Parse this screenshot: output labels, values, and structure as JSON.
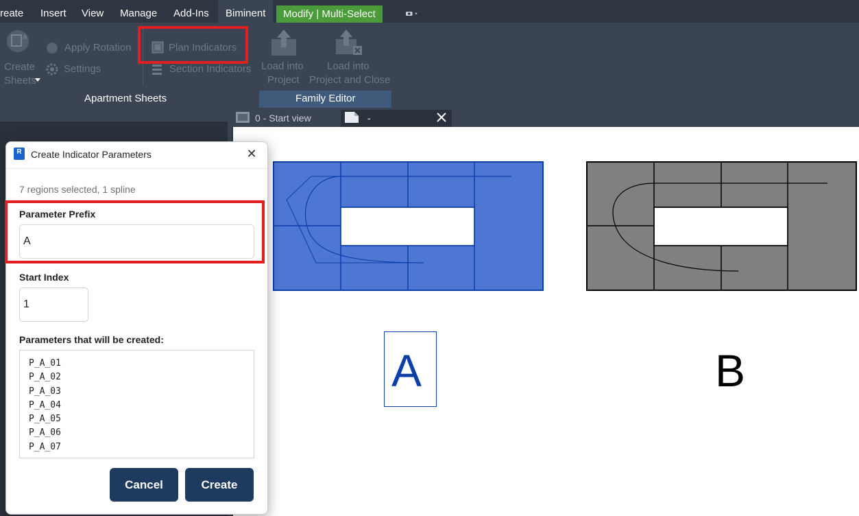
{
  "menu": {
    "items": [
      "reate",
      "Insert",
      "View",
      "Manage",
      "Add-Ins",
      "Biminent"
    ],
    "context_tab": "Modify | Multi-Select",
    "active_tab": "Biminent"
  },
  "ribbon": {
    "create_sheets": [
      "Create",
      "Sheets"
    ],
    "apply_rotation": "Apply Rotation",
    "settings": "Settings",
    "plan_indicators": "Plan Indicators",
    "section_indicators": "Section Indicators",
    "load_into_project": [
      "Load into",
      "Project"
    ],
    "load_into_project_close": [
      "Load into",
      "Project and Close"
    ],
    "panel_apartment_sheets": "Apartment Sheets",
    "panel_family_editor": "Family Editor"
  },
  "doc_tabs": {
    "tab1": "0 - Start view",
    "tab2": "-"
  },
  "dialog": {
    "title": "Create Indicator Parameters",
    "app_icon_text": "R",
    "selection_info": "7 regions selected, 1 spline",
    "prefix_label": "Parameter Prefix",
    "prefix_value": "A",
    "start_index_label": "Start Index",
    "start_index_value": "1",
    "params_label": "Parameters that will be created:",
    "params": [
      "P_A_01",
      "P_A_02",
      "P_A_03",
      "P_A_04",
      "P_A_05",
      "P_A_06",
      "P_A_07"
    ],
    "cancel_label": "Cancel",
    "create_label": "Create"
  },
  "canvas": {
    "label_a": "A",
    "label_b": "B"
  },
  "colors": {
    "highlight_red": "#e02020",
    "selected_blue": "#4e77d4",
    "region_gray": "#808080",
    "context_green": "#4b9b3a",
    "button_navy": "#1e3a5f"
  }
}
